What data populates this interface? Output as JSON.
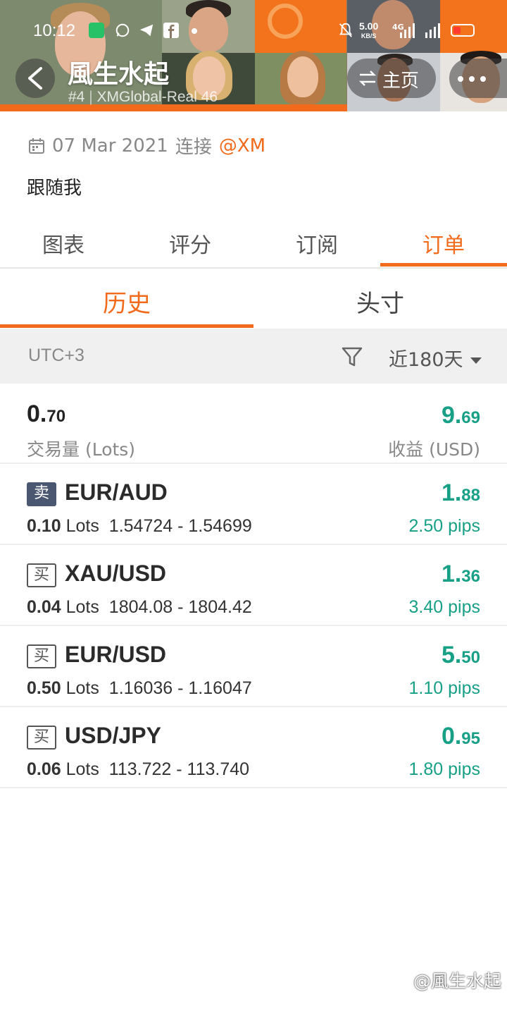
{
  "status": {
    "time": "10:12",
    "net_speed": "5.00",
    "net_unit": "KB/S",
    "net_type": "4G"
  },
  "header": {
    "name": "風生水起",
    "rank": "#4",
    "account": "XMGlobal-Real 46",
    "home_label": "主页"
  },
  "profile": {
    "connect_date": "07 Mar 2021",
    "connect_text": "连接",
    "broker": "@XM",
    "bio": "跟随我"
  },
  "tabs": [
    {
      "label": "图表"
    },
    {
      "label": "评分"
    },
    {
      "label": "订阅"
    },
    {
      "label": "订单"
    }
  ],
  "subtabs": [
    {
      "label": "历史"
    },
    {
      "label": "头寸"
    }
  ],
  "filter": {
    "timezone": "UTC+3",
    "range": "近180天"
  },
  "summary": {
    "volume_int": "0.",
    "volume_dec": "70",
    "volume_label": "交易量 (Lots)",
    "pnl_int": "9.",
    "pnl_dec": "69",
    "pnl_label": "收益 (USD)"
  },
  "orders": [
    {
      "side": "卖",
      "symbol": "EUR/AUD",
      "lots": "0.10",
      "lots_unit": "Lots",
      "range": "1.54724 - 1.54699",
      "pnl_int": "1.",
      "pnl_dec": "88",
      "pips": "2.50 pips"
    },
    {
      "side": "买",
      "symbol": "XAU/USD",
      "lots": "0.04",
      "lots_unit": "Lots",
      "range": "1804.08 - 1804.42",
      "pnl_int": "1.",
      "pnl_dec": "36",
      "pips": "3.40 pips"
    },
    {
      "side": "买",
      "symbol": "EUR/USD",
      "lots": "0.50",
      "lots_unit": "Lots",
      "range": "1.16036 - 1.16047",
      "pnl_int": "5.",
      "pnl_dec": "50",
      "pips": "1.10 pips"
    },
    {
      "side": "买",
      "symbol": "USD/JPY",
      "lots": "0.06",
      "lots_unit": "Lots",
      "range": "113.722 - 113.740",
      "pnl_int": "0.",
      "pnl_dec": "95",
      "pips": "1.80 pips"
    }
  ],
  "watermark": "@風生水起",
  "colors": {
    "accent": "#f26a1b",
    "profit": "#17a085",
    "sell_badge": "#4b5670"
  }
}
